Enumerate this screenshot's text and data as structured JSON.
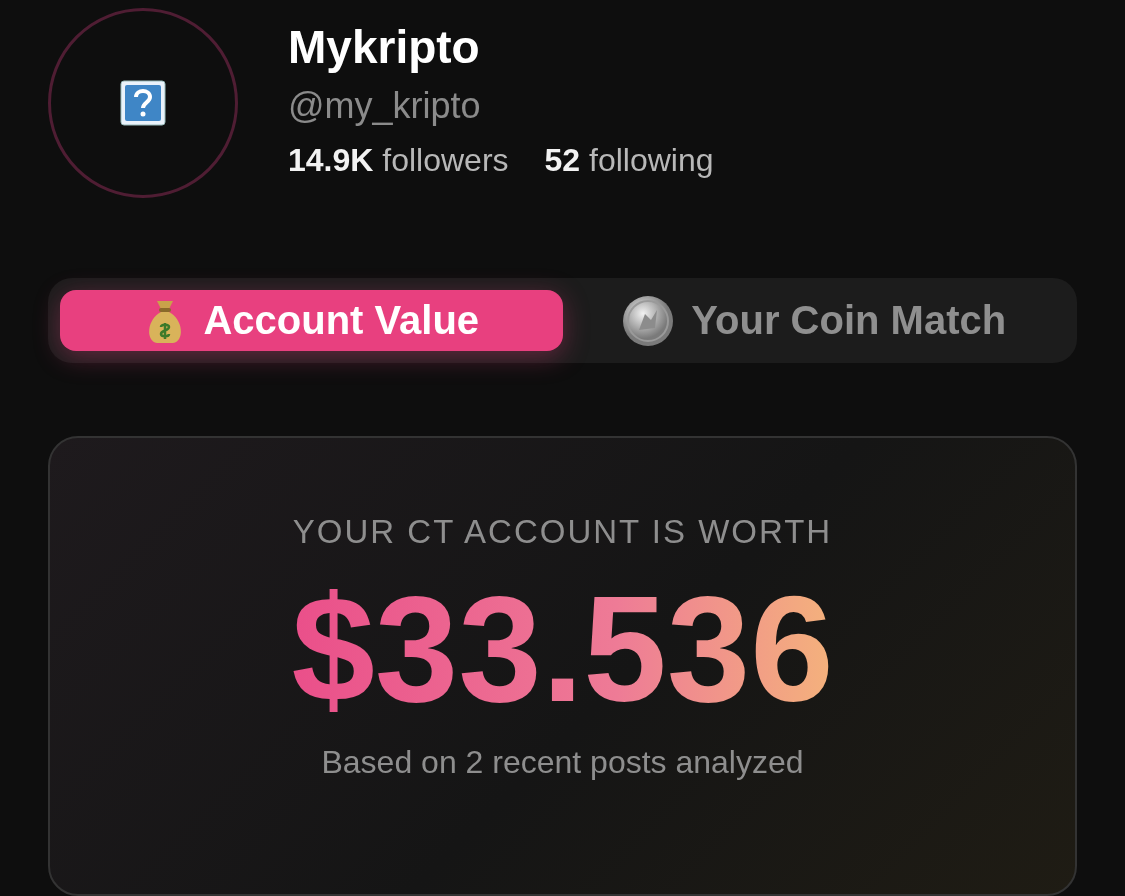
{
  "profile": {
    "name": "Mykripto",
    "handle": "@my_kripto",
    "stats": [
      {
        "count": "14.9K",
        "label": "followers"
      },
      {
        "count": "52",
        "label": "following"
      }
    ]
  },
  "tabs": [
    {
      "label": "Account Value",
      "kind": "money",
      "selected": true
    },
    {
      "label": "Your Coin Match",
      "kind": "coin",
      "selected": false
    }
  ],
  "card": {
    "caption": "YOUR CT ACCOUNT IS WORTH",
    "value": "$33.536",
    "note": "Based on 2 recent posts analyzed"
  }
}
